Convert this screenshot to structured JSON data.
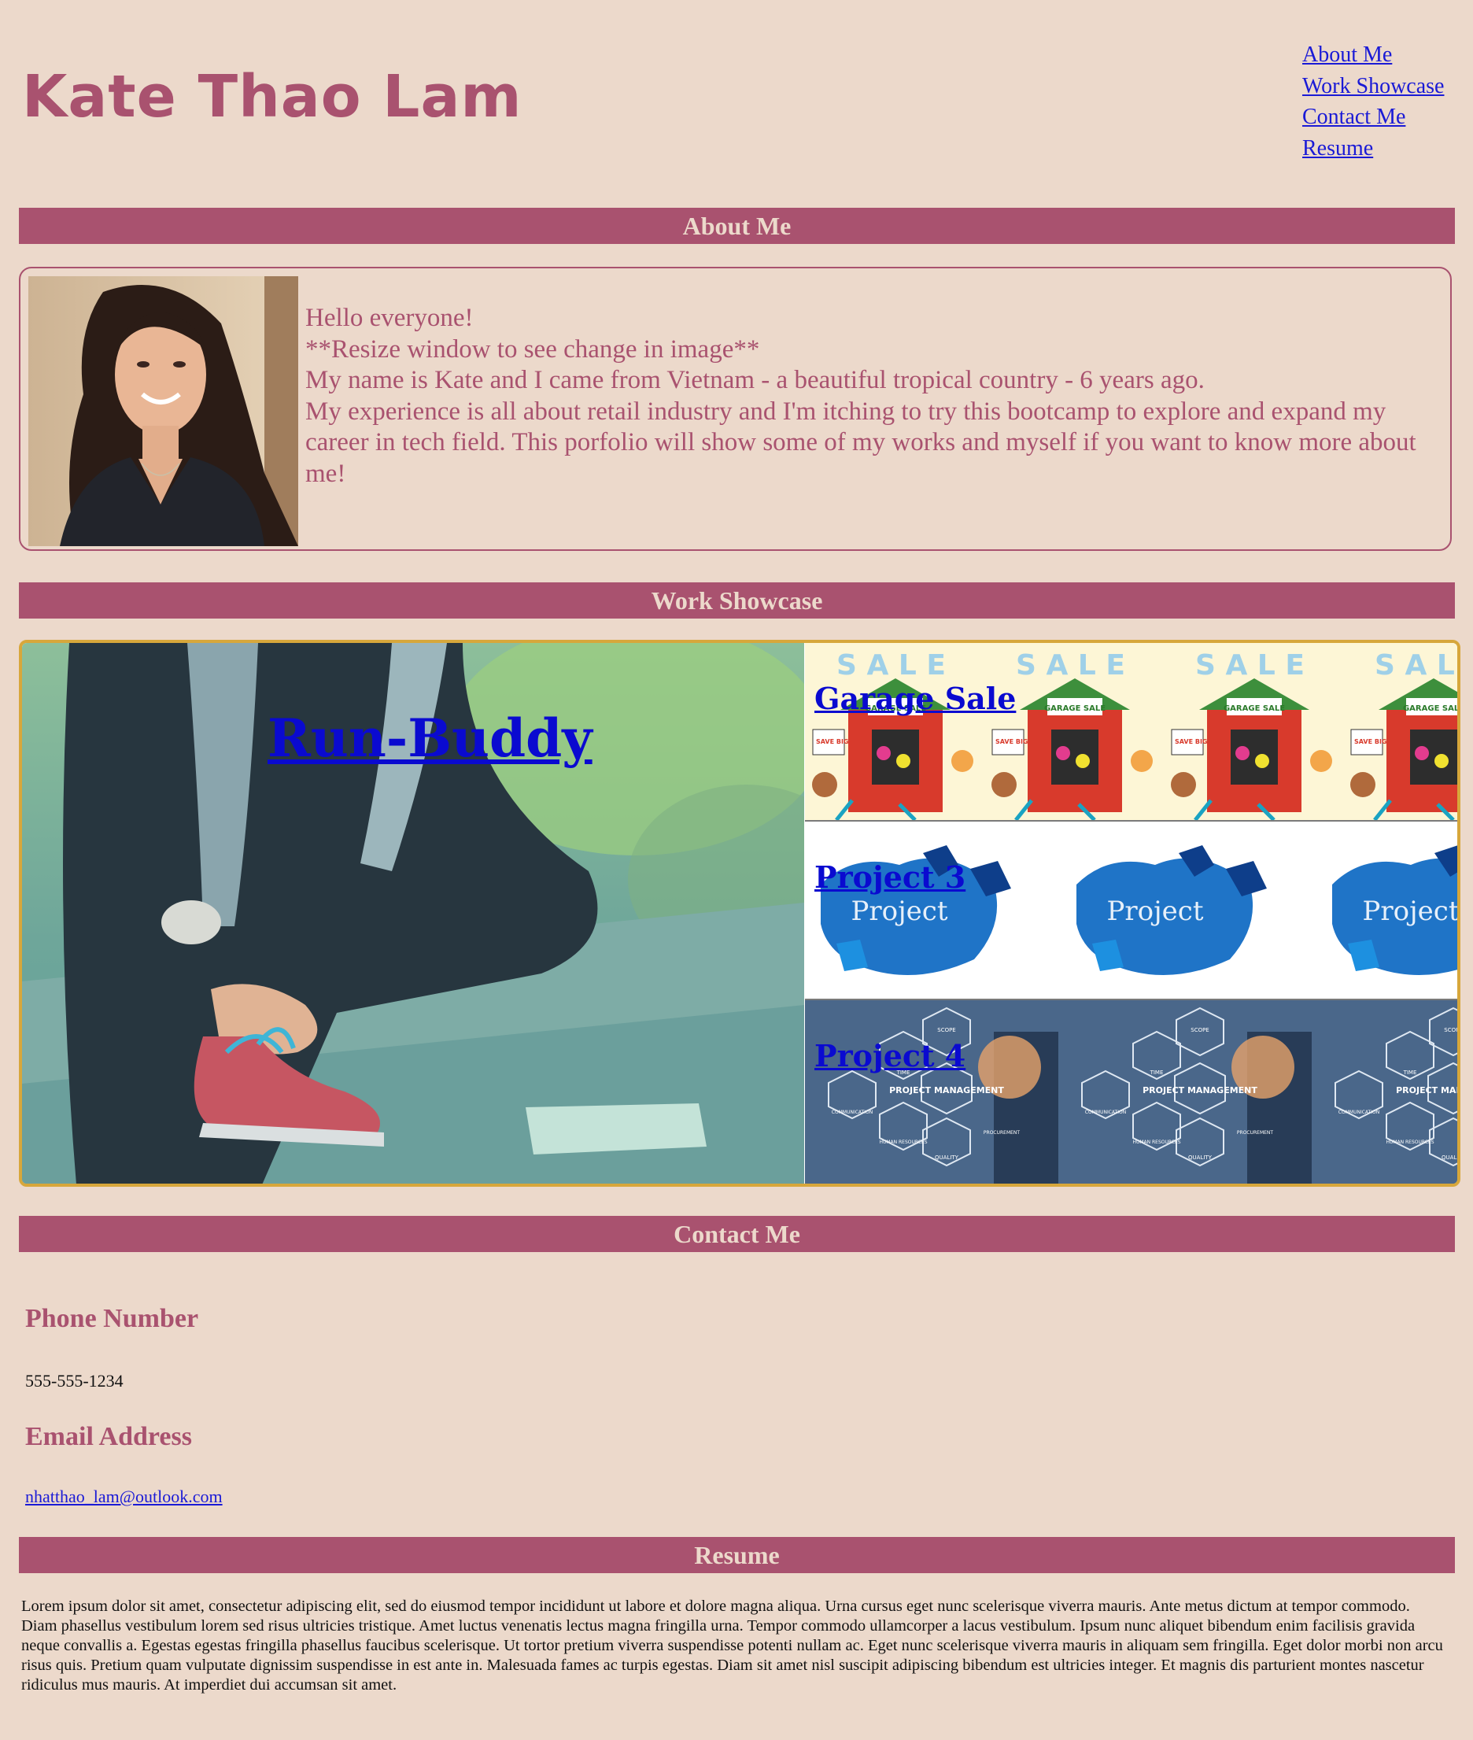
{
  "header": {
    "title": "Kate Thao Lam"
  },
  "nav": {
    "items": [
      {
        "label": "About Me"
      },
      {
        "label": "Work Showcase"
      },
      {
        "label": "Contact Me"
      },
      {
        "label": "Resume"
      }
    ]
  },
  "sections": {
    "about": "About Me",
    "work": "Work Showcase",
    "contact": "Contact Me",
    "resume": "Resume"
  },
  "about": {
    "lines": [
      "Hello everyone!",
      "**Resize window to see change in image**",
      "My name is Kate and I came from Vietnam - a beautiful tropical country - 6 years ago.",
      "My experience is all about retail industry and I'm itching to try this bootcamp to explore and expand my career in tech field. This porfolio will show some of my works and myself if you want to know more about me!"
    ]
  },
  "work": {
    "featured": "Run-Buddy",
    "projects": [
      {
        "label": "Garage Sale"
      },
      {
        "label": "Project 3"
      },
      {
        "label": "Project 4"
      }
    ],
    "image_text": {
      "sale_banner": "S A L E",
      "garage_sign": "GARAGE SALE",
      "big_sign": "SAVE BIG!",
      "puzzle_word": "Project",
      "pm_center": "PROJECT MANAGEMENT",
      "pm_labels": [
        "SCOPE",
        "TIME",
        "COMMUNICATION",
        "HUMAN RESOURCES",
        "QUALITY",
        "PROCUREMENT"
      ]
    }
  },
  "contact": {
    "phone_heading": "Phone Number",
    "phone": "555-555-1234",
    "email_heading": "Email Address",
    "email": "nhatthao_lam@outlook.com"
  },
  "resume": {
    "text": "Lorem ipsum dolor sit amet, consectetur adipiscing elit, sed do eiusmod tempor incididunt ut labore et dolore magna aliqua. Urna cursus eget nunc scelerisque viverra mauris. Ante metus dictum at tempor commodo. Diam phasellus vestibulum lorem sed risus ultricies tristique. Amet luctus venenatis lectus magna fringilla urna. Tempor commodo ullamcorper a lacus vestibulum. Ipsum nunc aliquet bibendum enim facilisis gravida neque convallis a. Egestas egestas fringilla phasellus faucibus scelerisque. Ut tortor pretium viverra suspendisse potenti nullam ac. Eget nunc scelerisque viverra mauris in aliquam sem fringilla. Eget dolor morbi non arcu risus quis. Pretium quam vulputate dignissim suspendisse in est ante in. Malesuada fames ac turpis egestas. Diam sit amet nisl suscipit adipiscing bibendum est ultricies integer. Et magnis dis parturient montes nascetur ridiculus mus mauris. At imperdiet dui accumsan sit amet."
  },
  "colors": {
    "background": "#ecd9cb",
    "accent": "#a9526f",
    "showcase_border": "#d7a73b",
    "link": "#1a1ad6"
  }
}
